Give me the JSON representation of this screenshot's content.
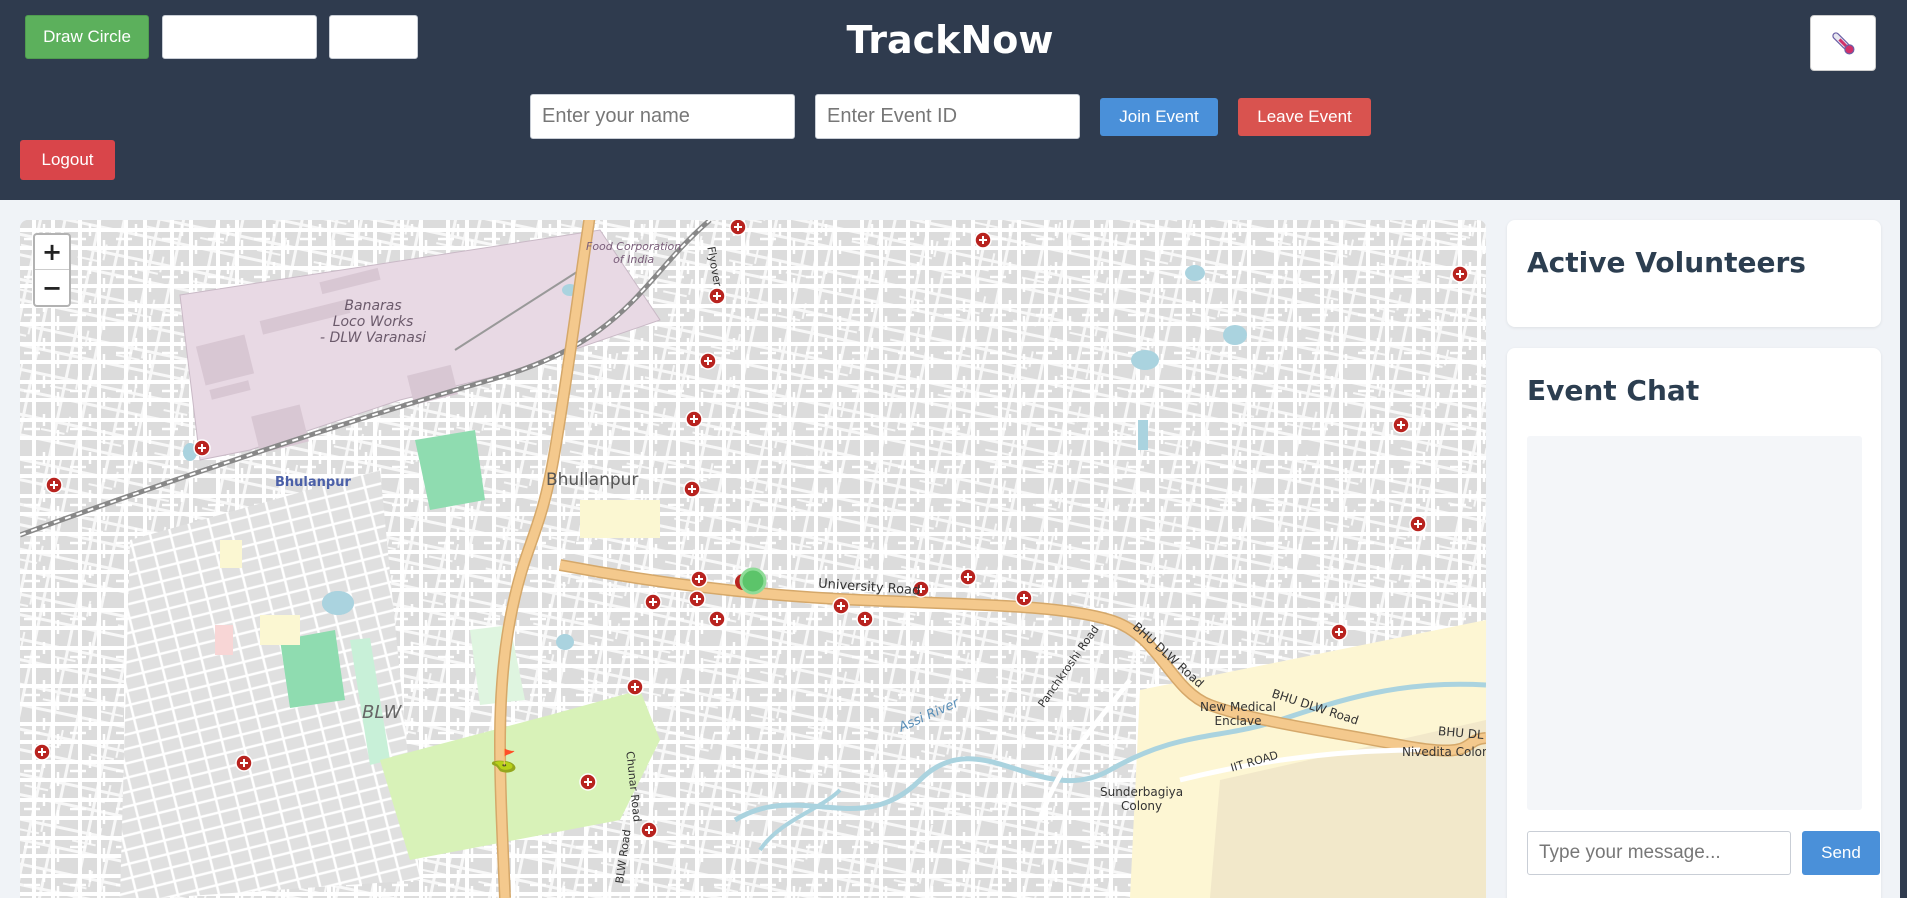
{
  "header": {
    "title": "TrackNow",
    "draw_circle_label": "Draw Circle",
    "name_placeholder": "Enter your name",
    "event_placeholder": "Enter Event ID",
    "join_label": "Join Event",
    "leave_label": "Leave Event",
    "logout_label": "Logout",
    "theme_icon": "thermometer-icon"
  },
  "map": {
    "zoom_in": "+",
    "zoom_out": "−",
    "labels": {
      "fci": "Food Corporation\nof India",
      "blw_works": "Banaras\nLoco Works\n- DLW Varanasi",
      "bhulanpur_station": "Bhulanpur",
      "bhullanpur": "Bhullanpur",
      "blw": "BLW",
      "flyover": "Flyover",
      "university_road": "University Road",
      "assi_river": "Assi River",
      "panchkroshi": "Panchkroshi Road",
      "bhu_dlw_1": "BHU DLW Road",
      "bhu_dlw_2": "BHU DLW Road",
      "bhu_dlw_3": "BHU DL",
      "new_medical": "New Medical\nEnclave",
      "iit_road": "IIT ROAD",
      "nivedita": "Nivedita Colony",
      "sunderbagiya": "Sunderbagiya\nColony",
      "chunar": "Chunar Road",
      "blw_road": "BLW Road"
    },
    "colors": {
      "road_major": "#f4c98d",
      "industrial": "#e8d9e4",
      "park": "#d8f2b8",
      "water": "#aad3df",
      "marker_red": "#b8231f",
      "user_green": "#5cc46a"
    }
  },
  "volunteers": {
    "title": "Active Volunteers"
  },
  "chat": {
    "title": "Event Chat",
    "message_placeholder": "Type your message...",
    "send_label": "Send"
  }
}
